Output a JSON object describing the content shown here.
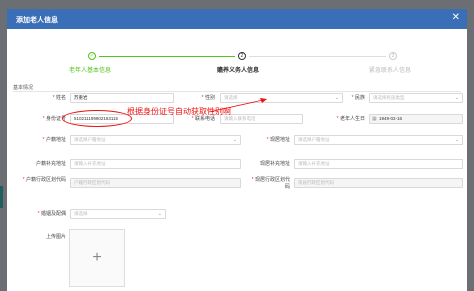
{
  "modal": {
    "title": "添加老人信息",
    "close_glyph": "✕"
  },
  "steps": [
    {
      "label": "老年人基本信息",
      "icon": "✓",
      "state": "done",
      "color": "#52c41a"
    },
    {
      "label": "赡养义务人信息",
      "icon": "2",
      "state": "current",
      "color": "#333333"
    },
    {
      "label": "紧急联系人信息",
      "icon": "3",
      "state": "pending",
      "color": "#bbbbbb"
    }
  ],
  "section": {
    "title": "基本情况"
  },
  "form": {
    "name": {
      "label": "姓名",
      "required": "*",
      "value": "苏重岩"
    },
    "gender": {
      "label": "性别",
      "required": "*",
      "placeholder": "请选择"
    },
    "ethnicity": {
      "label": "民族",
      "required": "*",
      "placeholder": "请选择民族类型"
    },
    "id_no": {
      "label": "身份证号",
      "required": "*",
      "value": "510211199902163115"
    },
    "phone": {
      "label": "联系电话",
      "required": "*",
      "placeholder": "请输入联系电话"
    },
    "birthday": {
      "label": "老年人生日",
      "required": "*",
      "value": "1949-02-16"
    },
    "hukou_addr": {
      "label": "户籍地址",
      "required": "*",
      "placeholder": "请选择户籍地址"
    },
    "residence_addr": {
      "label": "现居地址",
      "required": "*",
      "placeholder": "请选择户籍地址"
    },
    "hukou_detail": {
      "label": "户籍补充地址",
      "placeholder": "请输入补充地址"
    },
    "residence_detail": {
      "label": "现居补充地址",
      "placeholder": "请输入补充地址"
    },
    "hukou_code": {
      "label": "户籍行政区划代码",
      "required": "*",
      "placeholder": "户籍行政区划代码"
    },
    "residence_code": {
      "label": "现居行政区划代码",
      "required": "*",
      "placeholder": "现居行政区划代码"
    },
    "marital": {
      "label": "婚姻及配偶",
      "required": "*",
      "placeholder": "请选择"
    },
    "photo": {
      "label": "上传图片",
      "plus": "+"
    }
  },
  "annotation": {
    "text": "根据身份证号自动获取性别啊",
    "color": "#e11111"
  }
}
